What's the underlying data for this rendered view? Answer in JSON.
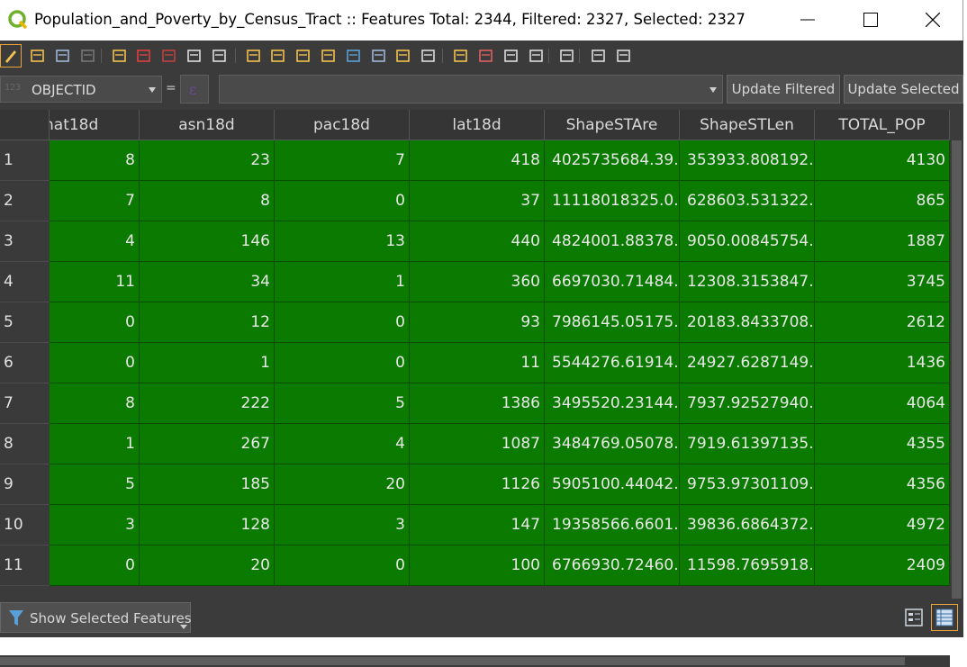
{
  "window": {
    "title": "Population_and_Poverty_by_Census_Tract :: Features Total: 2344, Filtered: 2327, Selected: 2327"
  },
  "toolbar": {
    "icons": [
      "toggle-edit-icon",
      "multi-edit-icon",
      "save-edits-icon",
      "reload-icon",
      "add-feature-icon",
      "delete-feature-icon",
      "cut-icon",
      "copy-icon",
      "paste-icon",
      "select-by-expression-icon",
      "select-all-icon",
      "invert-selection-icon",
      "deselect-icon",
      "filter-icon",
      "move-selection-top-icon",
      "pan-to-selected-icon",
      "zoom-to-selected-icon",
      "new-field-icon",
      "delete-field-icon",
      "field-calculator-icon",
      "conditional-formatting-icon",
      "actions-icon",
      "dock-icon",
      "help-icon"
    ]
  },
  "filterbar": {
    "field_type": "123",
    "field": "OBJECTID",
    "operator": "=",
    "value": "",
    "update_filtered": "Update Filtered",
    "update_selected": "Update Selected"
  },
  "table": {
    "columns": [
      "nat18d",
      "asn18d",
      "pac18d",
      "lat18d",
      "ShapeSTAre",
      "ShapeSTLen",
      "TOTAL_POP"
    ],
    "rows": [
      {
        "num": "1",
        "cells": [
          "8",
          "23",
          "7",
          "418",
          "4025735684.39...",
          "353933.808192...",
          "4130"
        ]
      },
      {
        "num": "2",
        "cells": [
          "7",
          "8",
          "0",
          "37",
          "11118018325.0...",
          "628603.531322...",
          "865"
        ]
      },
      {
        "num": "3",
        "cells": [
          "4",
          "146",
          "13",
          "440",
          "4824001.88378...",
          "9050.00845754...",
          "1887"
        ]
      },
      {
        "num": "4",
        "cells": [
          "11",
          "34",
          "1",
          "360",
          "6697030.71484...",
          "12308.3153847...",
          "3745"
        ]
      },
      {
        "num": "5",
        "cells": [
          "0",
          "12",
          "0",
          "93",
          "7986145.05175...",
          "20183.8433708...",
          "2612"
        ]
      },
      {
        "num": "6",
        "cells": [
          "0",
          "1",
          "0",
          "11",
          "5544276.61914...",
          "24927.6287149...",
          "1436"
        ]
      },
      {
        "num": "7",
        "cells": [
          "8",
          "222",
          "5",
          "1386",
          "3495520.23144...",
          "7937.92527940...",
          "4064"
        ]
      },
      {
        "num": "8",
        "cells": [
          "1",
          "267",
          "4",
          "1087",
          "3484769.05078...",
          "7919.61397135...",
          "4355"
        ]
      },
      {
        "num": "9",
        "cells": [
          "5",
          "185",
          "20",
          "1126",
          "5905100.44042...",
          "9753.97301109...",
          "4356"
        ]
      },
      {
        "num": "10",
        "cells": [
          "3",
          "128",
          "3",
          "147",
          "19358566.6601...",
          "39836.6864372...",
          "4972"
        ]
      },
      {
        "num": "11",
        "cells": [
          "0",
          "20",
          "0",
          "100",
          "6766930.72460...",
          "11598.7695918...",
          "2409"
        ]
      }
    ]
  },
  "bottom": {
    "show_features": "Show Selected Features"
  },
  "colors": {
    "selected_row": "#0b7a00",
    "dark_bg": "#3b3b3b",
    "accent": "#e8a33d"
  }
}
